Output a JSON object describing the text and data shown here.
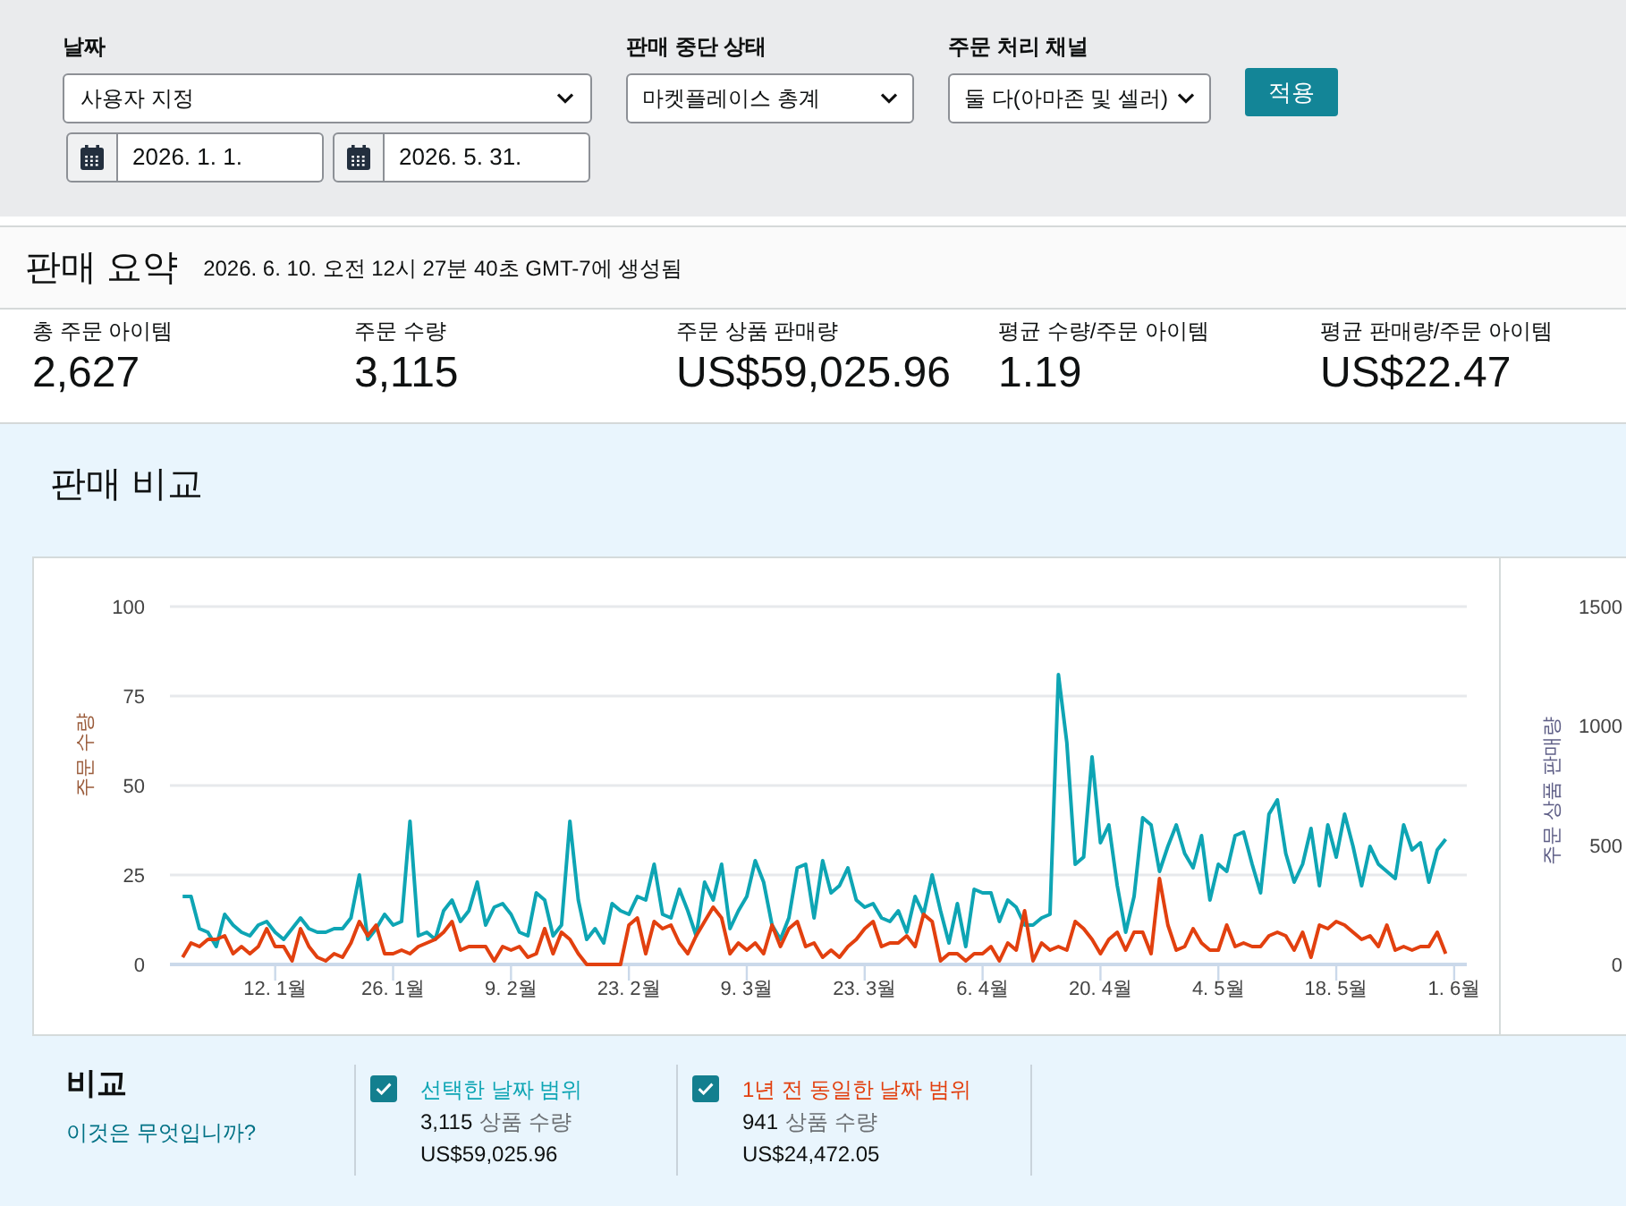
{
  "filter_bar": {
    "date_filter": {
      "label": "날짜",
      "value": "사용자 지정",
      "start_date": "2026. 1. 1.",
      "end_date": "2026. 5. 31."
    },
    "selects": [
      {
        "label": "판매 중단 상태",
        "value": "마켓플레이스 총계"
      },
      {
        "label": "주문 처리 채널",
        "value": "둘 다(아마존 및 셀러)"
      }
    ],
    "apply_button": "적용"
  },
  "summary": {
    "title": "판매 요약",
    "generated": "2026. 6. 10. 오전 12시 27분 40초 GMT-7에 생성됨",
    "metrics": [
      {
        "label": "총 주문 아이템",
        "value": "2,627"
      },
      {
        "label": "주문 수량",
        "value": "3,115"
      },
      {
        "label": "주문 상품 판매량",
        "value": "US$59,025.96"
      },
      {
        "label": "평균 수량/주문 아이템",
        "value": "1.19"
      },
      {
        "label": "평균 판매량/주문 아이템",
        "value": "US$22.47"
      }
    ]
  },
  "comparison": {
    "title": "판매 비교",
    "chart_data": {
      "type": "line",
      "ylabel": "주문 수량",
      "grid": true,
      "ylim": [
        0,
        100
      ],
      "yticks": [
        0,
        25,
        50,
        75,
        100
      ],
      "categories": [
        null,
        null,
        null,
        null,
        null,
        null,
        null,
        null,
        null,
        null,
        null,
        "12. 1월",
        null,
        null,
        null,
        null,
        null,
        null,
        null,
        null,
        null,
        null,
        null,
        null,
        null,
        "26. 1월",
        null,
        null,
        null,
        null,
        null,
        null,
        null,
        null,
        null,
        null,
        null,
        null,
        null,
        "9. 2월",
        null,
        null,
        null,
        null,
        null,
        null,
        null,
        null,
        null,
        null,
        null,
        null,
        null,
        "23. 2월",
        null,
        null,
        null,
        null,
        null,
        null,
        null,
        null,
        null,
        null,
        null,
        null,
        null,
        "9. 3월",
        null,
        null,
        null,
        null,
        null,
        null,
        null,
        null,
        null,
        null,
        null,
        null,
        null,
        "23. 3월",
        null,
        null,
        null,
        null,
        null,
        null,
        null,
        null,
        null,
        null,
        null,
        null,
        null,
        "6. 4월",
        null,
        null,
        null,
        null,
        null,
        null,
        null,
        null,
        null,
        null,
        null,
        null,
        null,
        "20. 4월",
        null,
        null,
        null,
        null,
        null,
        null,
        null,
        null,
        null,
        null,
        null,
        null,
        null,
        "4. 5월",
        null,
        null,
        null,
        null,
        null,
        null,
        null,
        null,
        null,
        null,
        null,
        null,
        null,
        "18. 5월",
        null,
        null,
        null,
        null,
        null,
        null,
        null,
        null,
        null,
        null,
        null,
        null,
        null,
        "1. 6월"
      ],
      "series": [
        {
          "color": "#0ea5b4",
          "values": [
            19,
            19,
            10,
            9,
            5,
            14,
            11,
            9,
            8,
            11,
            12,
            9,
            7,
            10,
            13,
            10,
            9,
            9,
            10,
            10,
            13,
            25,
            7,
            10,
            14,
            11,
            12,
            40,
            8,
            9,
            7,
            15,
            18,
            12,
            15,
            23,
            11,
            16,
            17,
            14,
            9,
            8,
            20,
            18,
            8,
            11,
            40,
            18,
            7,
            10,
            6,
            17,
            15,
            14,
            19,
            18,
            28,
            14,
            13,
            21,
            15,
            8,
            23,
            18,
            28,
            10,
            15,
            19,
            29,
            23,
            11,
            7,
            13,
            27,
            28,
            13,
            29,
            20,
            22,
            27,
            18,
            16,
            17,
            13,
            12,
            15,
            9,
            19,
            14,
            25,
            15,
            6,
            17,
            5,
            21,
            20,
            20,
            12,
            18,
            16,
            11,
            11,
            13,
            14,
            81,
            62,
            28,
            30,
            58,
            34,
            39,
            22,
            9,
            19,
            41,
            39,
            26,
            33,
            39,
            31,
            27,
            36,
            18,
            28,
            26,
            36,
            37,
            28,
            20,
            42,
            46,
            31,
            23,
            28,
            38,
            22,
            39,
            30,
            42,
            33,
            22,
            33,
            28,
            26,
            24,
            39,
            32,
            34,
            23,
            32,
            35,
            null
          ]
        },
        {
          "color": "#e2400f",
          "values": [
            2,
            6,
            5,
            7,
            7,
            8,
            3,
            5,
            3,
            5,
            10,
            5,
            5,
            1,
            10,
            5,
            2,
            1,
            3,
            2,
            6,
            12,
            8,
            11,
            3,
            3,
            4,
            3,
            5,
            6,
            7,
            9,
            12,
            4,
            5,
            5,
            5,
            1,
            5,
            4,
            5,
            2,
            3,
            10,
            3,
            9,
            7,
            3,
            0,
            0,
            0,
            0,
            0,
            11,
            13,
            3,
            12,
            10,
            11,
            6,
            3,
            8,
            12,
            16,
            13,
            3,
            6,
            4,
            6,
            3,
            11,
            5,
            10,
            12,
            5,
            6,
            2,
            4,
            2,
            5,
            7,
            10,
            12,
            5,
            6,
            6,
            8,
            5,
            14,
            12,
            1,
            3,
            3,
            1,
            3,
            3,
            5,
            1,
            6,
            4,
            15,
            1,
            6,
            4,
            5,
            4,
            12,
            10,
            7,
            3,
            7,
            9,
            4,
            9,
            9,
            3,
            24,
            11,
            4,
            5,
            10,
            6,
            4,
            4,
            11,
            5,
            6,
            5,
            5,
            8,
            9,
            8,
            4,
            9,
            2,
            11,
            10,
            12,
            11,
            9,
            7,
            8,
            5,
            11,
            4,
            5,
            4,
            5,
            5,
            9,
            3,
            null
          ]
        }
      ]
    },
    "secondary_axis": {
      "title": "주문 상품 판매량",
      "ticks": [
        "1500",
        "1000",
        "500",
        "0"
      ]
    },
    "legend": {
      "title": "비교",
      "help_link": "이것은 무엇입니까?",
      "items": [
        {
          "label": "선택한 날짜 범위",
          "checked": true,
          "color": "#0ea5b4",
          "count": "3,115",
          "unit": "상품 수량",
          "sales": "US$59,025.96"
        },
        {
          "label": "1년 전 동일한 날짜 범위",
          "checked": true,
          "color": "#e2400f",
          "count": "941",
          "unit": "상품 수량",
          "sales": "US$24,472.05"
        }
      ]
    }
  }
}
